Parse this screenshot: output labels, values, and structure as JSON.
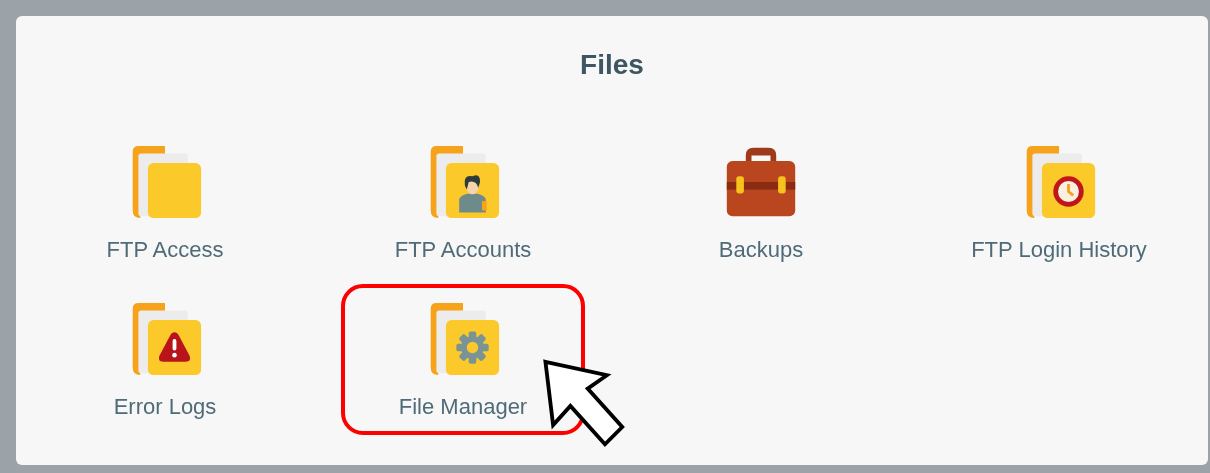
{
  "section": {
    "title": "Files"
  },
  "items": [
    {
      "label": "FTP Access",
      "kind": "folder-plain",
      "highlighted": false
    },
    {
      "label": "FTP Accounts",
      "kind": "folder-user",
      "highlighted": false
    },
    {
      "label": "Backups",
      "kind": "briefcase",
      "highlighted": false
    },
    {
      "label": "FTP Login History",
      "kind": "folder-clock",
      "highlighted": false
    },
    {
      "label": "Error Logs",
      "kind": "folder-warning",
      "highlighted": false
    },
    {
      "label": "File Manager",
      "kind": "folder-gear",
      "highlighted": true
    }
  ]
}
